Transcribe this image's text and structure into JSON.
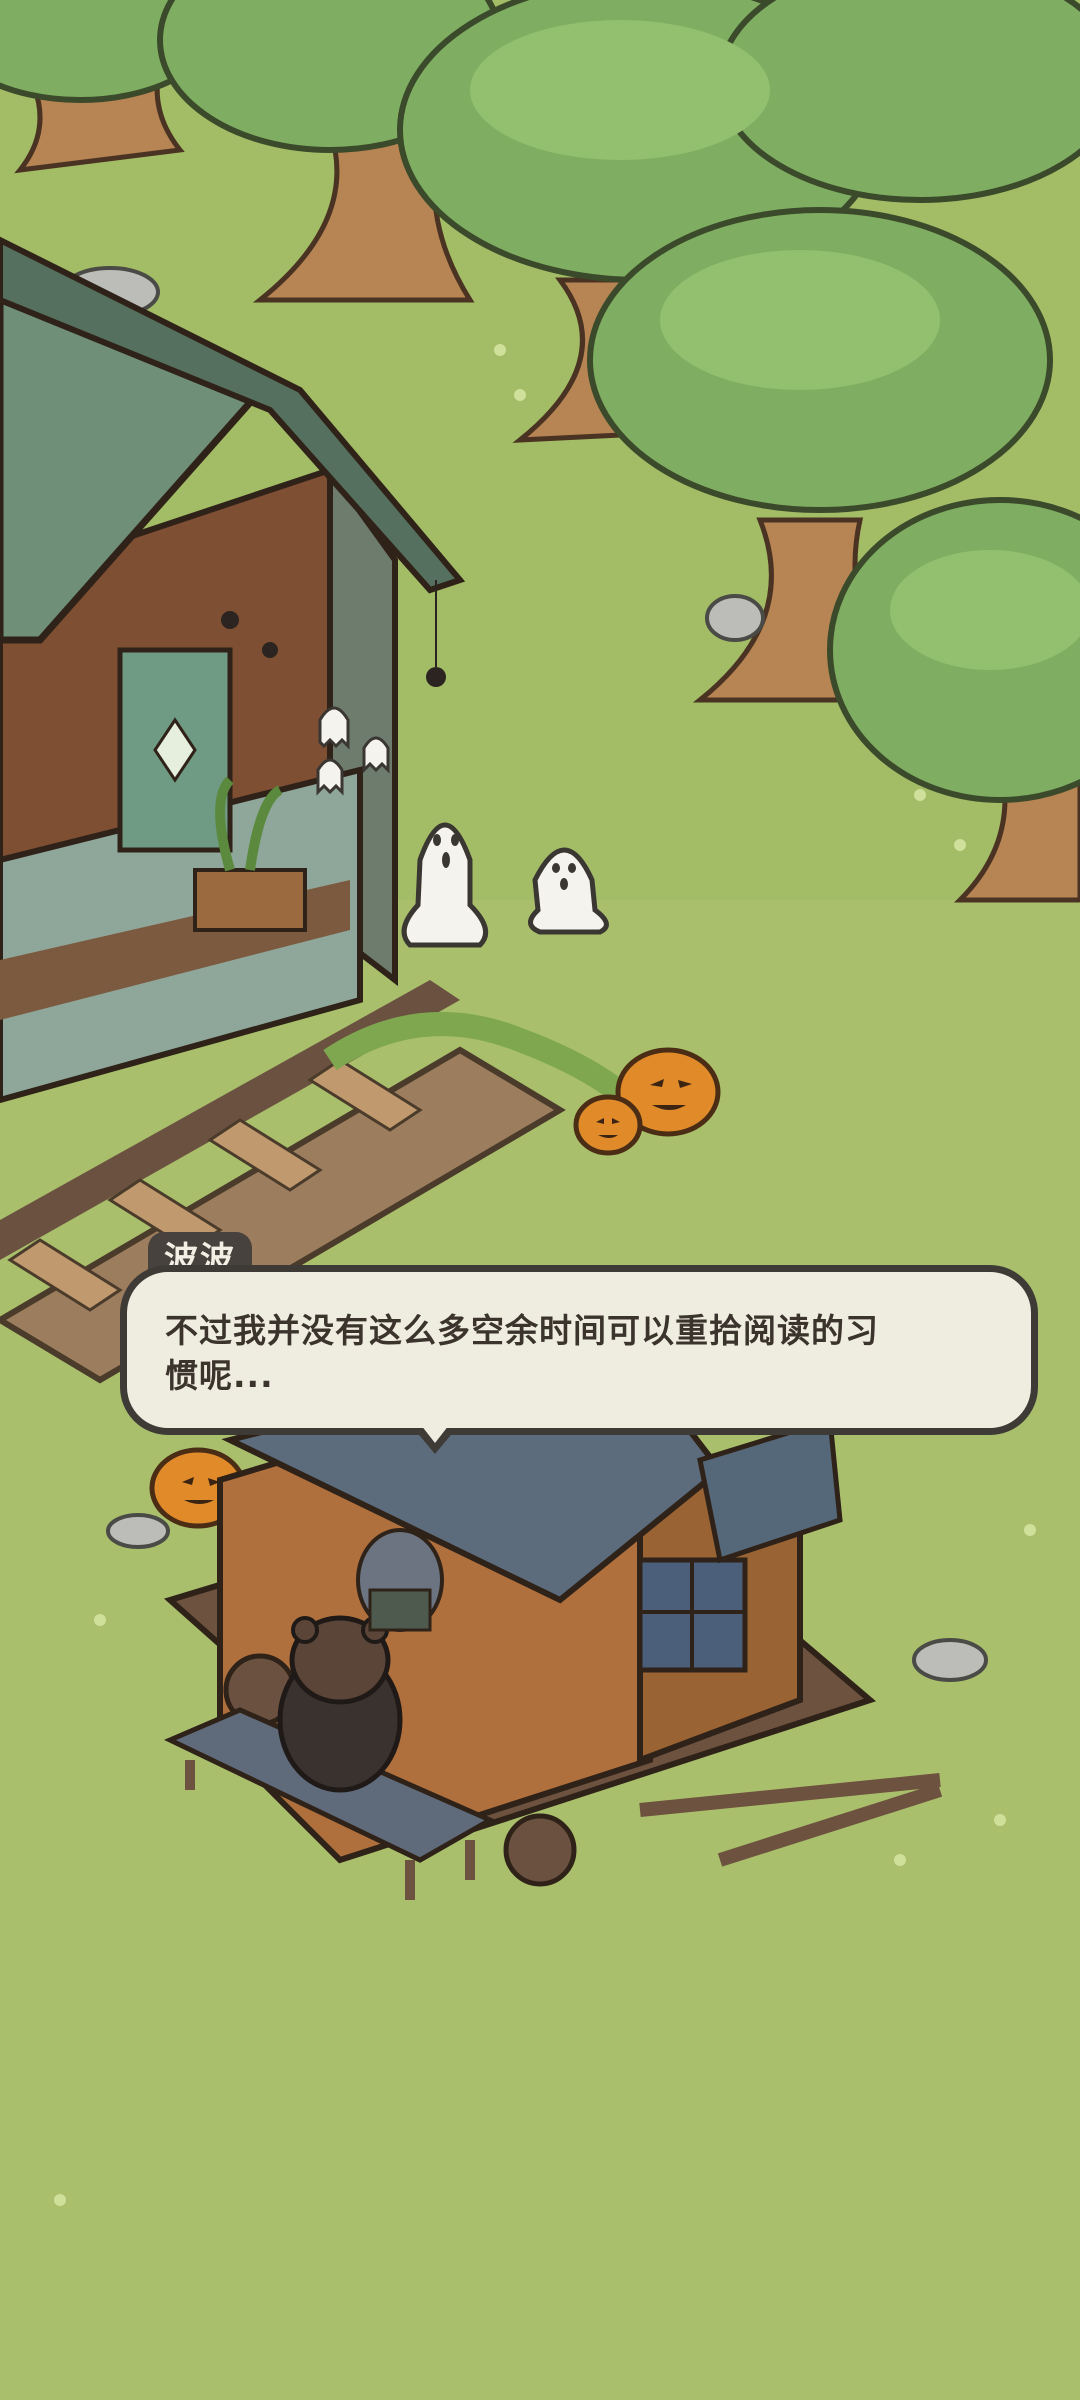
{
  "dialog": {
    "speaker": "波波",
    "line1": "不过我并没有这么多空余时间可以重拾阅读的习",
    "line2": "惯呢..."
  },
  "colors": {
    "grass": "#a9bf6c",
    "grass_dark": "#9bb262",
    "dialog_bg": "#efece0",
    "dialog_border": "#3e3b37",
    "name_tag": "#47423d",
    "tree_canopy": "#7fae62",
    "wood": "#8a5a3a",
    "roof_green": "#6f8f79",
    "roof_blue": "#5c6c7c",
    "pumpkin": "#e08a2a",
    "ghost": "#f5f3ee"
  },
  "scene": {
    "objects": [
      "tree",
      "wooden-house",
      "ghost",
      "pumpkin",
      "rail-track",
      "food-cart",
      "bear-character",
      "bench",
      "spider",
      "rock"
    ]
  }
}
